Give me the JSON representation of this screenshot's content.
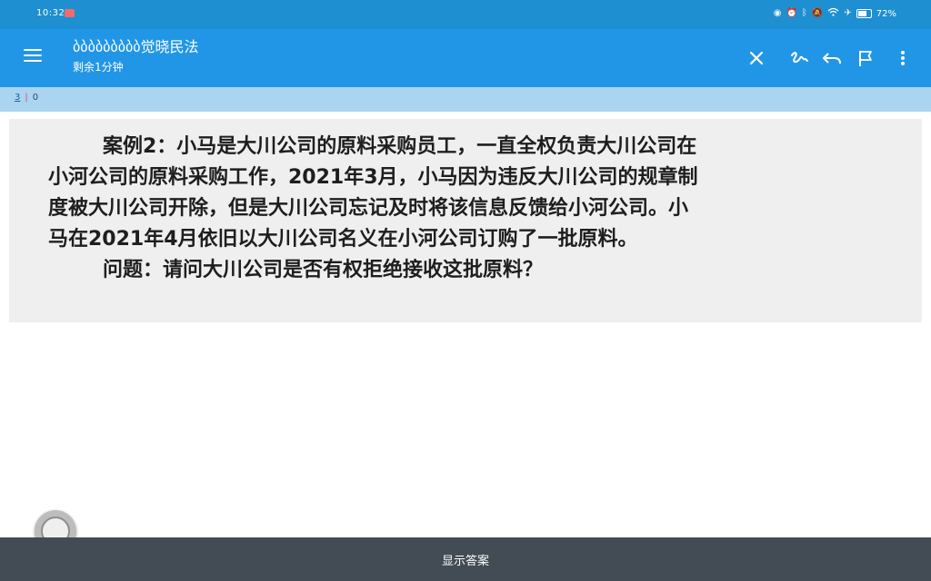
{
  "status_bar": {
    "time": "10:32",
    "battery": "72%",
    "battery_level": 0.72,
    "icons": [
      "eye-icon",
      "alarm-icon",
      "bluetooth-icon",
      "mute-icon",
      "wifi-icon",
      "airplane-icon",
      "battery-icon"
    ]
  },
  "toolbar": {
    "title": "ბბბბბბბბბ觉晓民法",
    "subtitle": "剩余1分钟",
    "icons": [
      "menu-icon",
      "close-icon",
      "handwriting-icon",
      "undo-icon",
      "flag-icon",
      "more-vert-icon"
    ]
  },
  "progress": {
    "current": "3",
    "separator": "|",
    "answered": "0"
  },
  "question": {
    "lines": [
      "案例2：小马是大川公司的原料采购员工，一直全权负责大川公司在",
      "小河公司的原料采购工作，2021年3月，小马因为违反大川公司的规章制",
      "度被大川公司开除，但是大川公司忘记及时将该信息反馈给小河公司。小",
      "马在2021年4月依旧以大川公司名义在小河公司订购了一批原料。",
      "问题：请问大川公司是否有权拒绝接收这批原料？"
    ]
  },
  "bottom": {
    "show_answer_label": "显示答案"
  },
  "colors": {
    "status_bar_bg": "#1e8fd0",
    "toolbar_bg": "#2196e6",
    "progress_bg": "#aad4ef",
    "card_bg": "#efefef",
    "bottom_bar_bg": "#434c54"
  }
}
